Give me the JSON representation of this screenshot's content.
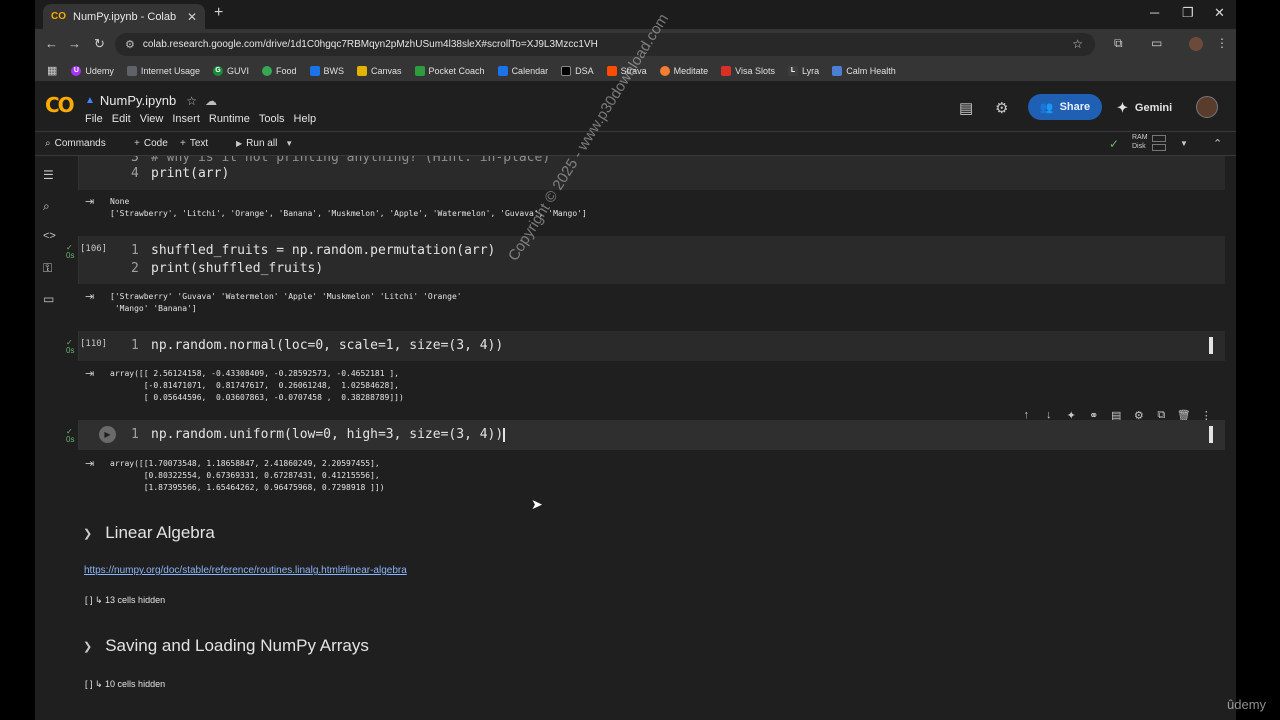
{
  "browser": {
    "tab_title": "NumPy.ipynb - Colab",
    "tab_favicon": "CO",
    "url": "colab.research.google.com/drive/1d1C0hgqc7RBMqyn2pMzhUSum4l38sleX#scrollTo=XJ9L3Mzcc1VH",
    "bookmarks": [
      "Udemy",
      "Internet Usage",
      "GUVI",
      "Food",
      "BWS",
      "Canvas",
      "Pocket Coach",
      "Calendar",
      "DSA",
      "Strava",
      "Meditate",
      "Visa Slots",
      "Lyra",
      "Calm Health"
    ],
    "bookmark_badges": [
      "U",
      "",
      "G",
      "",
      "",
      "",
      "",
      "",
      "",
      "",
      "",
      "",
      "L",
      ""
    ]
  },
  "colab": {
    "logo": "CO",
    "notebook_title": "NumPy.ipynb",
    "menu": [
      "File",
      "Edit",
      "View",
      "Insert",
      "Runtime",
      "Tools",
      "Help"
    ],
    "share_label": "Share",
    "gemini_label": "Gemini",
    "toolbar": {
      "commands": "Commands",
      "add_code": "Code",
      "add_text": "Text",
      "run_all": "Run all",
      "ram": "RAM",
      "disk": "Disk"
    }
  },
  "cells": [
    {
      "exec": "",
      "lines": [
        {
          "n": "3",
          "code": "# why is it not printing anything? (Hint: in-place)"
        },
        {
          "n": "4",
          "code": "print(arr)"
        }
      ],
      "output": "None\n['Strawberry', 'Litchi', 'Orange', 'Banana', 'Muskmelon', 'Apple', 'Watermelon', 'Guvava', 'Mango']"
    },
    {
      "exec": "[106]",
      "lines": [
        {
          "n": "1",
          "code": "shuffled_fruits = np.random.permutation(arr)"
        },
        {
          "n": "2",
          "code": "print(shuffled_fruits)"
        }
      ],
      "output": "['Strawberry' 'Guvava' 'Watermelon' 'Apple' 'Muskmelon' 'Litchi' 'Orange'\n 'Mango' 'Banana']"
    },
    {
      "exec": "[110]",
      "lines": [
        {
          "n": "1",
          "code": "np.random.normal(loc=0, scale=1, size=(3, 4))"
        }
      ],
      "output": "array([[ 2.56124158, -0.43308409, -0.28592573, -0.4652181 ],\n       [-0.81471071,  0.81747617,  0.26061248,  1.02584628],\n       [ 0.05644596,  0.03607863, -0.0707458 ,  0.38288789]])"
    },
    {
      "exec": "",
      "lines": [
        {
          "n": "1",
          "code": "np.random.uniform(low=0, high=3, size=(3, 4))"
        }
      ],
      "output": "array([[1.70073548, 1.18658847, 2.41860249, 2.20597455],\n       [0.80322554, 0.67369331, 0.67287431, 0.41215556],\n       [1.87395566, 1.65464262, 0.96475968, 0.7298918 ]])"
    }
  ],
  "check_mark": "✓",
  "check_time": "0s",
  "sections": [
    {
      "title": "Linear Algebra",
      "link": "https://numpy.org/doc/stable/reference/routines.linalg.html#linear-algebra",
      "hidden": "[ ] ↳ 13 cells hidden"
    },
    {
      "title": "Saving and Loading NumPy Arrays",
      "link": "",
      "hidden": "[ ] ↳ 10 cells hidden"
    }
  ],
  "watermark": "Copyright © 2025 - www.p30download.com",
  "udemy_badge": "ûdemy"
}
